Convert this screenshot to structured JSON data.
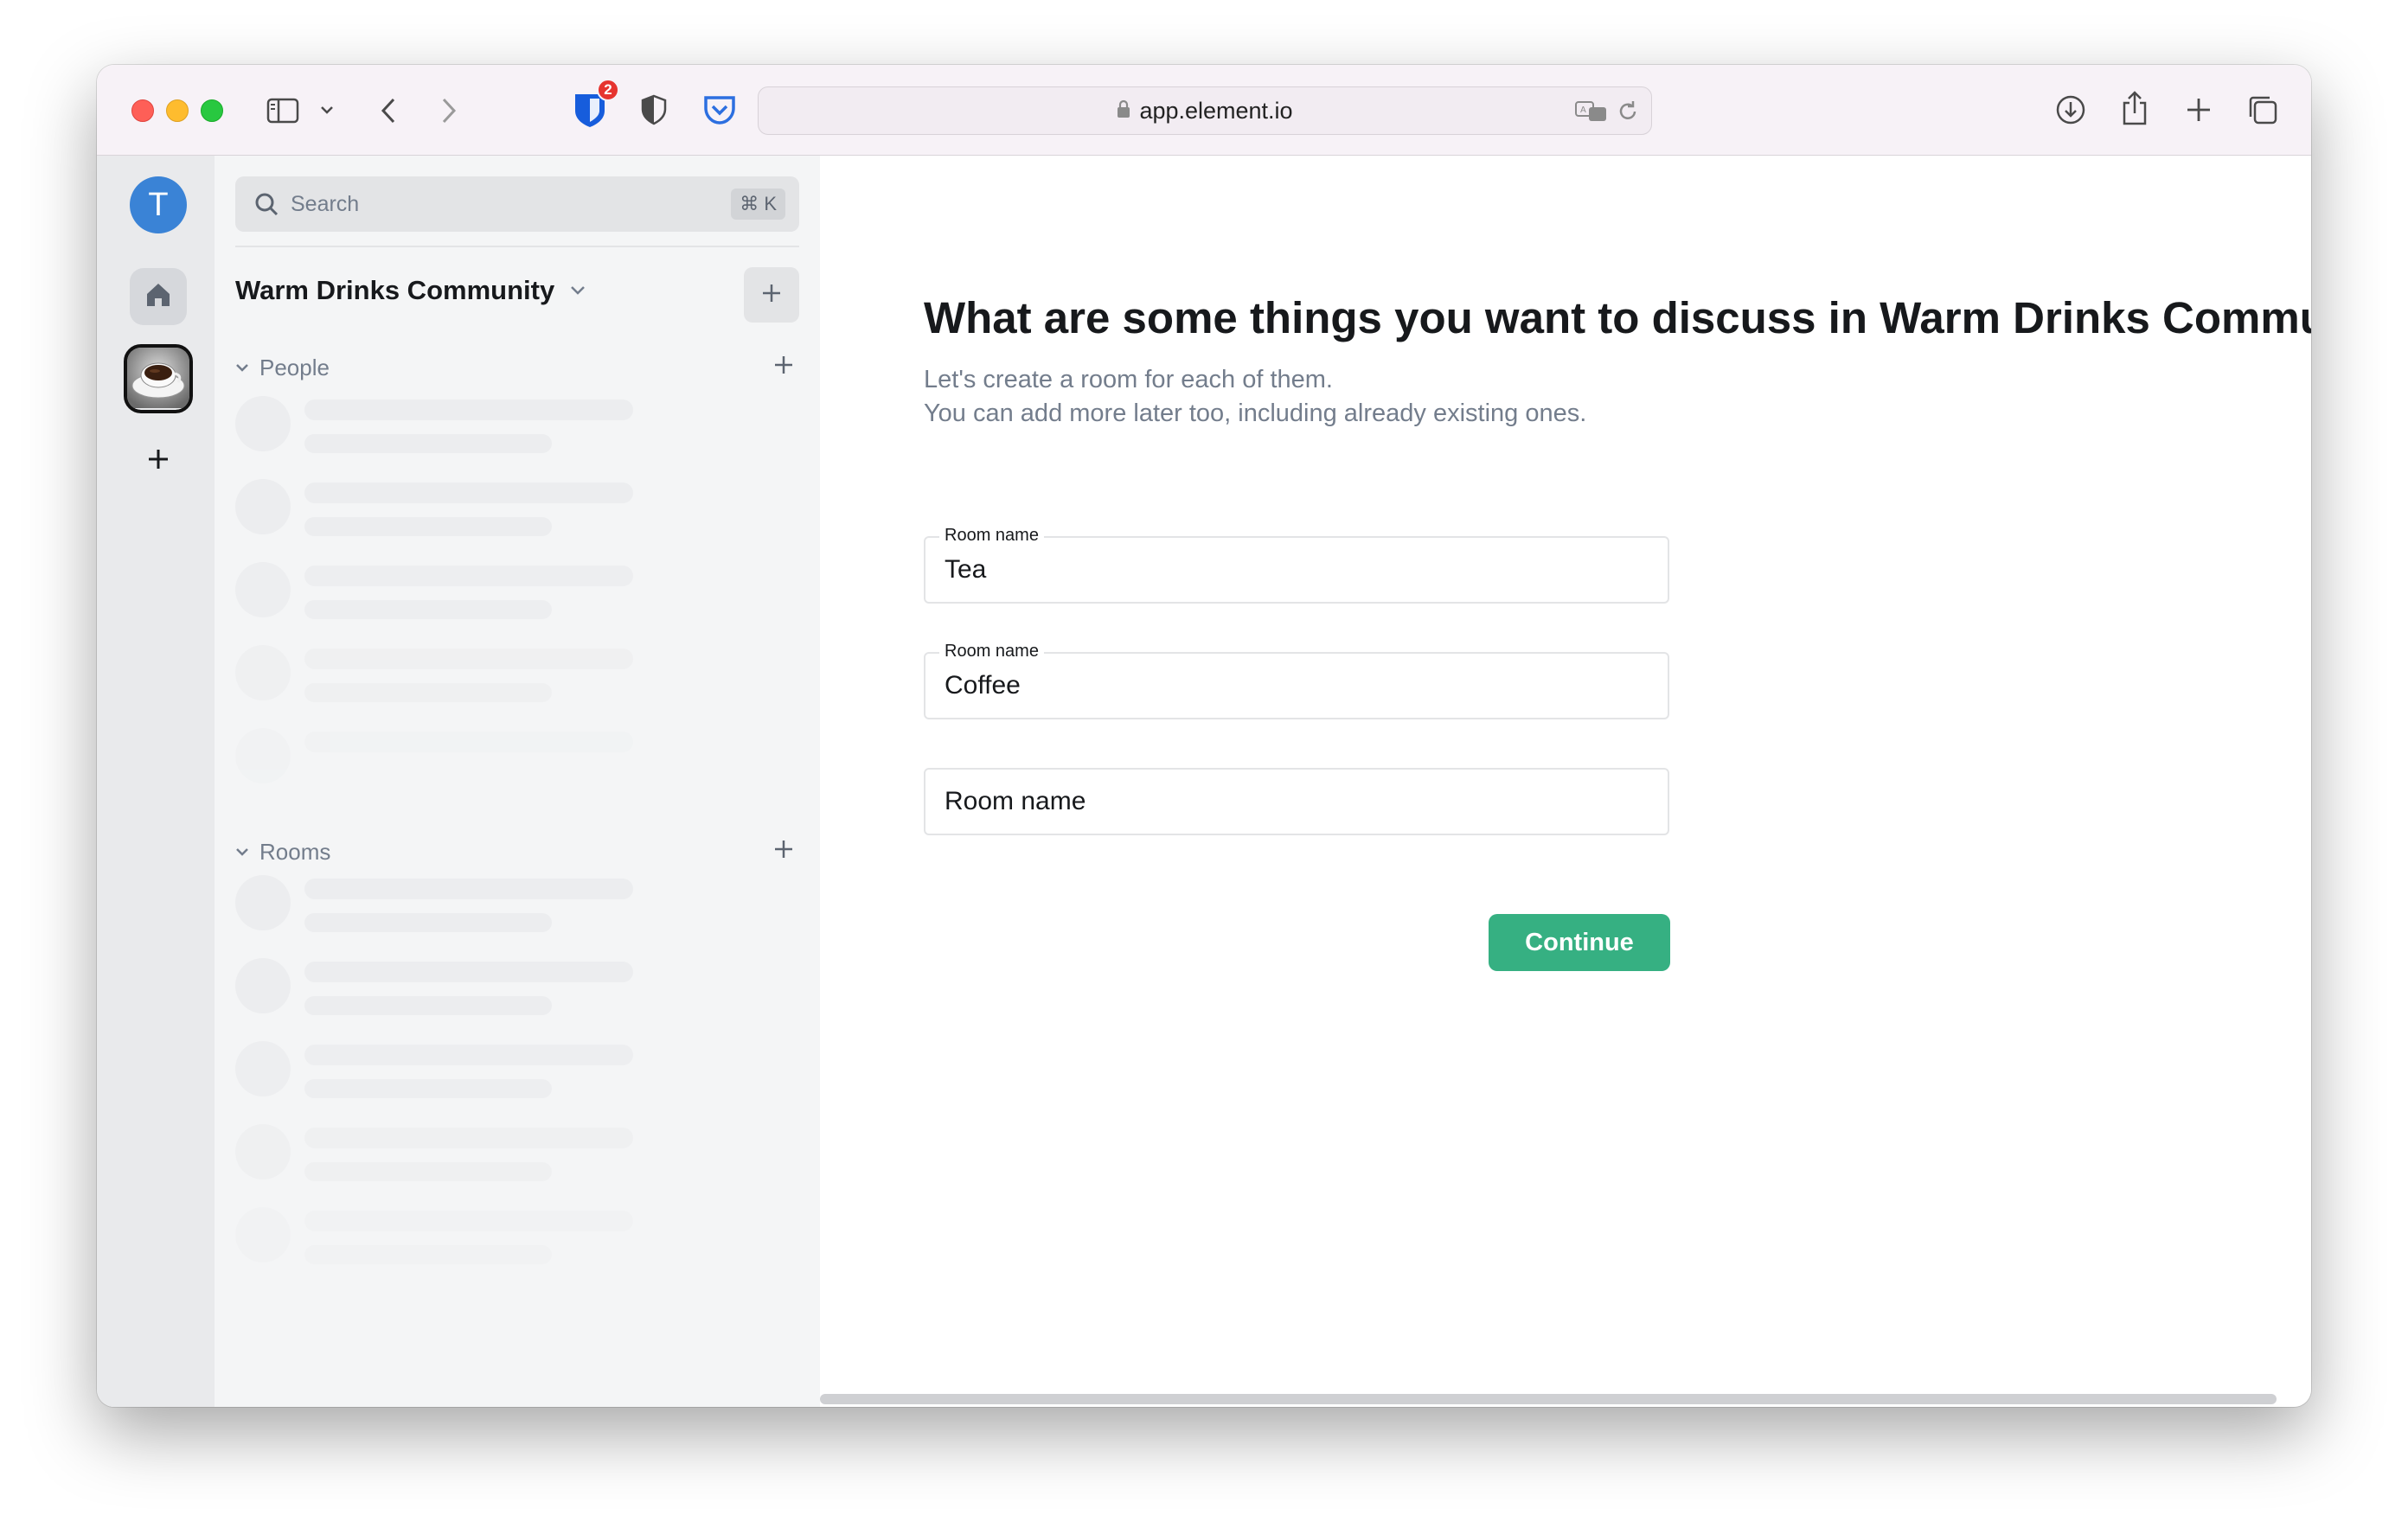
{
  "browser": {
    "url": "app.element.io",
    "extension_badge": "2"
  },
  "rail": {
    "user_initial": "T"
  },
  "room_list": {
    "search_placeholder": "Search",
    "search_shortcut": "⌘ K",
    "space_name": "Warm Drinks Community",
    "sections": [
      {
        "label": "People"
      },
      {
        "label": "Rooms"
      }
    ]
  },
  "main": {
    "heading": "What are some things you want to discuss in Warm Drinks Community?",
    "subtext_line1": "Let's create a room for each of them.",
    "subtext_line2": "You can add more later too, including already existing ones.",
    "fields": [
      {
        "label": "Room name",
        "value": "Tea"
      },
      {
        "label": "Room name",
        "value": "Coffee"
      },
      {
        "label": "Room name",
        "value": ""
      }
    ],
    "empty_placeholder": "Room name",
    "continue_label": "Continue"
  },
  "colors": {
    "accent": "#36b082",
    "avatar": "#3a83d6"
  }
}
